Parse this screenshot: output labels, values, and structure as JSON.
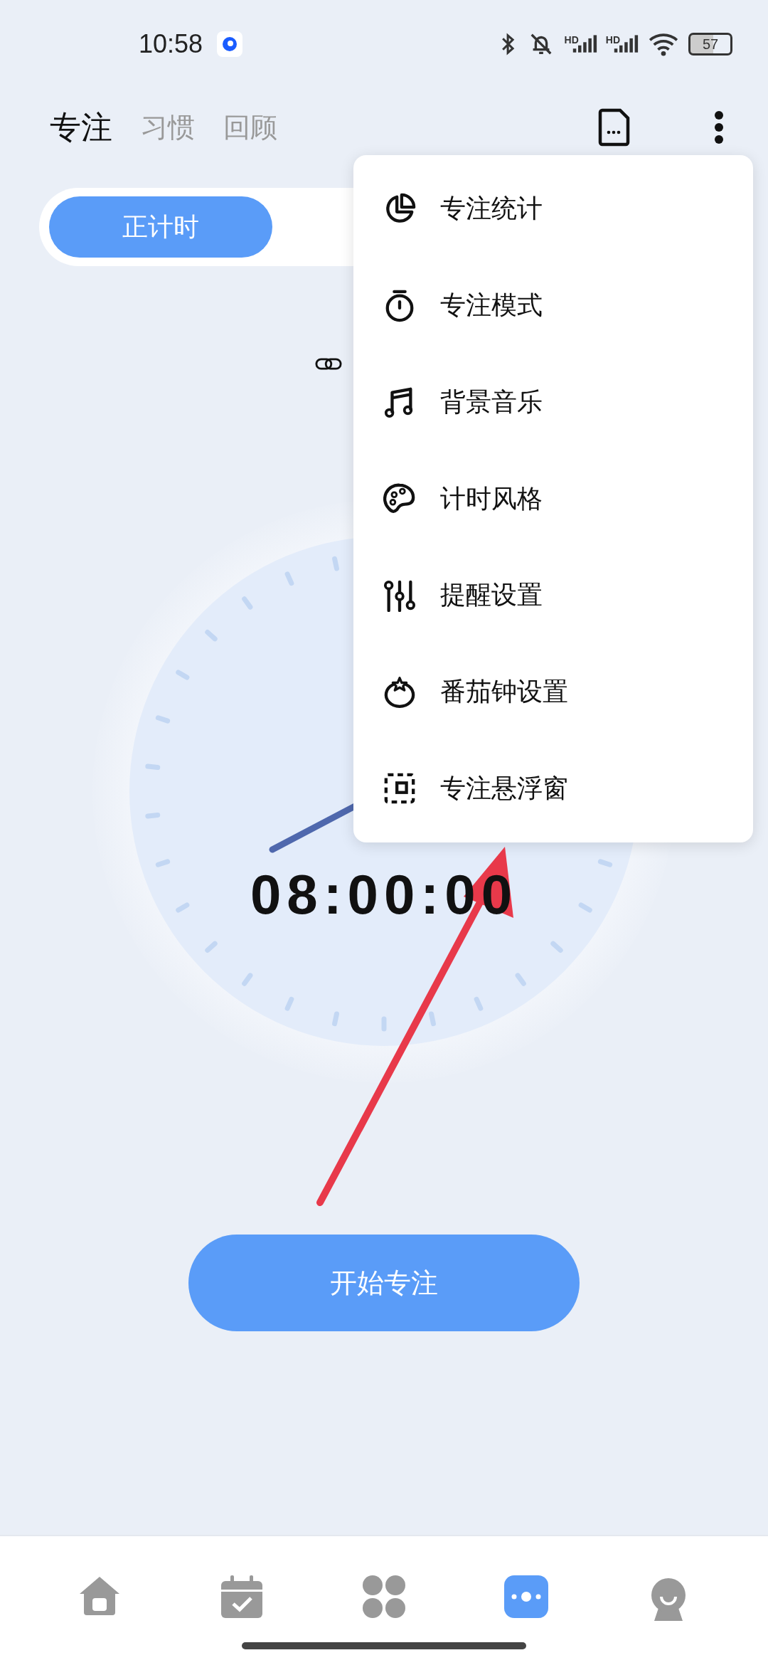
{
  "status_bar": {
    "time": "10:58",
    "signal_labels": [
      "HD",
      "HD"
    ],
    "battery": "57"
  },
  "header_tabs": [
    {
      "label": "专注",
      "selected": true
    },
    {
      "label": "习惯",
      "selected": false
    },
    {
      "label": "回顾",
      "selected": false
    }
  ],
  "timer_modes": [
    {
      "label": "正计时",
      "selected": true
    }
  ],
  "clock": {
    "time": "08:00:00"
  },
  "menu": {
    "items": [
      {
        "kind": "stats",
        "label": "专注统计"
      },
      {
        "kind": "timer",
        "label": "专注模式"
      },
      {
        "kind": "music",
        "label": "背景音乐"
      },
      {
        "kind": "palette",
        "label": "计时风格"
      },
      {
        "kind": "sliders",
        "label": "提醒设置"
      },
      {
        "kind": "tomato",
        "label": "番茄钟设置"
      },
      {
        "kind": "float",
        "label": "专注悬浮窗"
      }
    ]
  },
  "start_button": "开始专注",
  "bottom_nav": [
    {
      "kind": "home",
      "selected": false
    },
    {
      "kind": "calendar",
      "selected": false
    },
    {
      "kind": "grid",
      "selected": false
    },
    {
      "kind": "focus",
      "selected": true
    },
    {
      "kind": "profile",
      "selected": false
    }
  ]
}
